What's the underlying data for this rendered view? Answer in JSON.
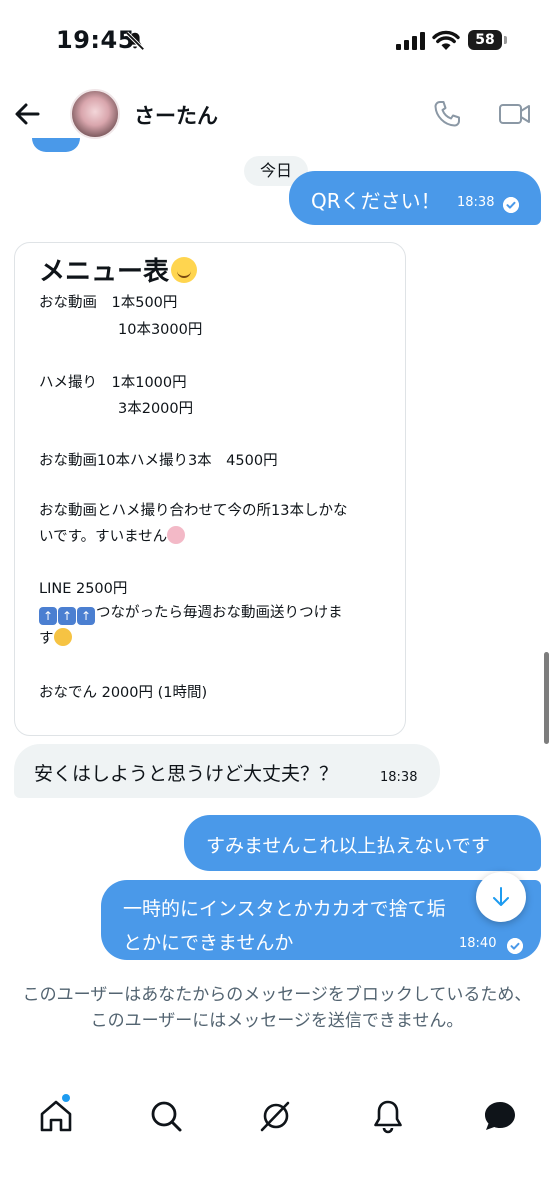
{
  "status_bar": {
    "time": "19:45",
    "battery": "58"
  },
  "header": {
    "contact_name": "さーたん"
  },
  "conversation": {
    "day_label": "今日",
    "messages": [
      {
        "id": "m1",
        "direction": "outgoing",
        "text": "QRください！",
        "time": "18:38",
        "read": true
      },
      {
        "id": "m2",
        "direction": "incoming",
        "card_title": "メニュー表",
        "lines": [
          "おな動画　1本500円",
          "10本3000円",
          "ハメ撮り　1本1000円",
          "3本2000円",
          "おな動画10本ハメ撮り3本　4500円",
          "おな動画とハメ撮り合わせて今の所13本しかな",
          "いです。すいません",
          "LINE 2500円",
          "つながったら毎週おな動画送りつけま",
          "す",
          "おなでん 2000円 (1時間)"
        ]
      },
      {
        "id": "m3",
        "direction": "incoming",
        "text": "安くはしようと思うけど大丈夫？？",
        "time": "18:38"
      },
      {
        "id": "m4",
        "direction": "outgoing",
        "text": "すみませんこれ以上払えないです"
      },
      {
        "id": "m5",
        "direction": "outgoing",
        "lines": [
          "一時的にインスタとかカカオで捨て垢",
          "とかにできませんか"
        ],
        "time": "18:40",
        "read": true
      }
    ],
    "blocked_notice": "このユーザーはあなたからのメッセージをブロックしているため、このユーザーにはメッセージを送信できません。"
  },
  "bottom_nav": {
    "items": [
      {
        "icon": "home-icon"
      },
      {
        "icon": "search-icon"
      },
      {
        "icon": "grok-icon"
      },
      {
        "icon": "notifications-icon"
      },
      {
        "icon": "messages-icon"
      }
    ]
  },
  "colors": {
    "outgoing_bubble": "#4a99e9",
    "incoming_bubble": "#eff3f4",
    "accent": "#1d9bf0"
  }
}
